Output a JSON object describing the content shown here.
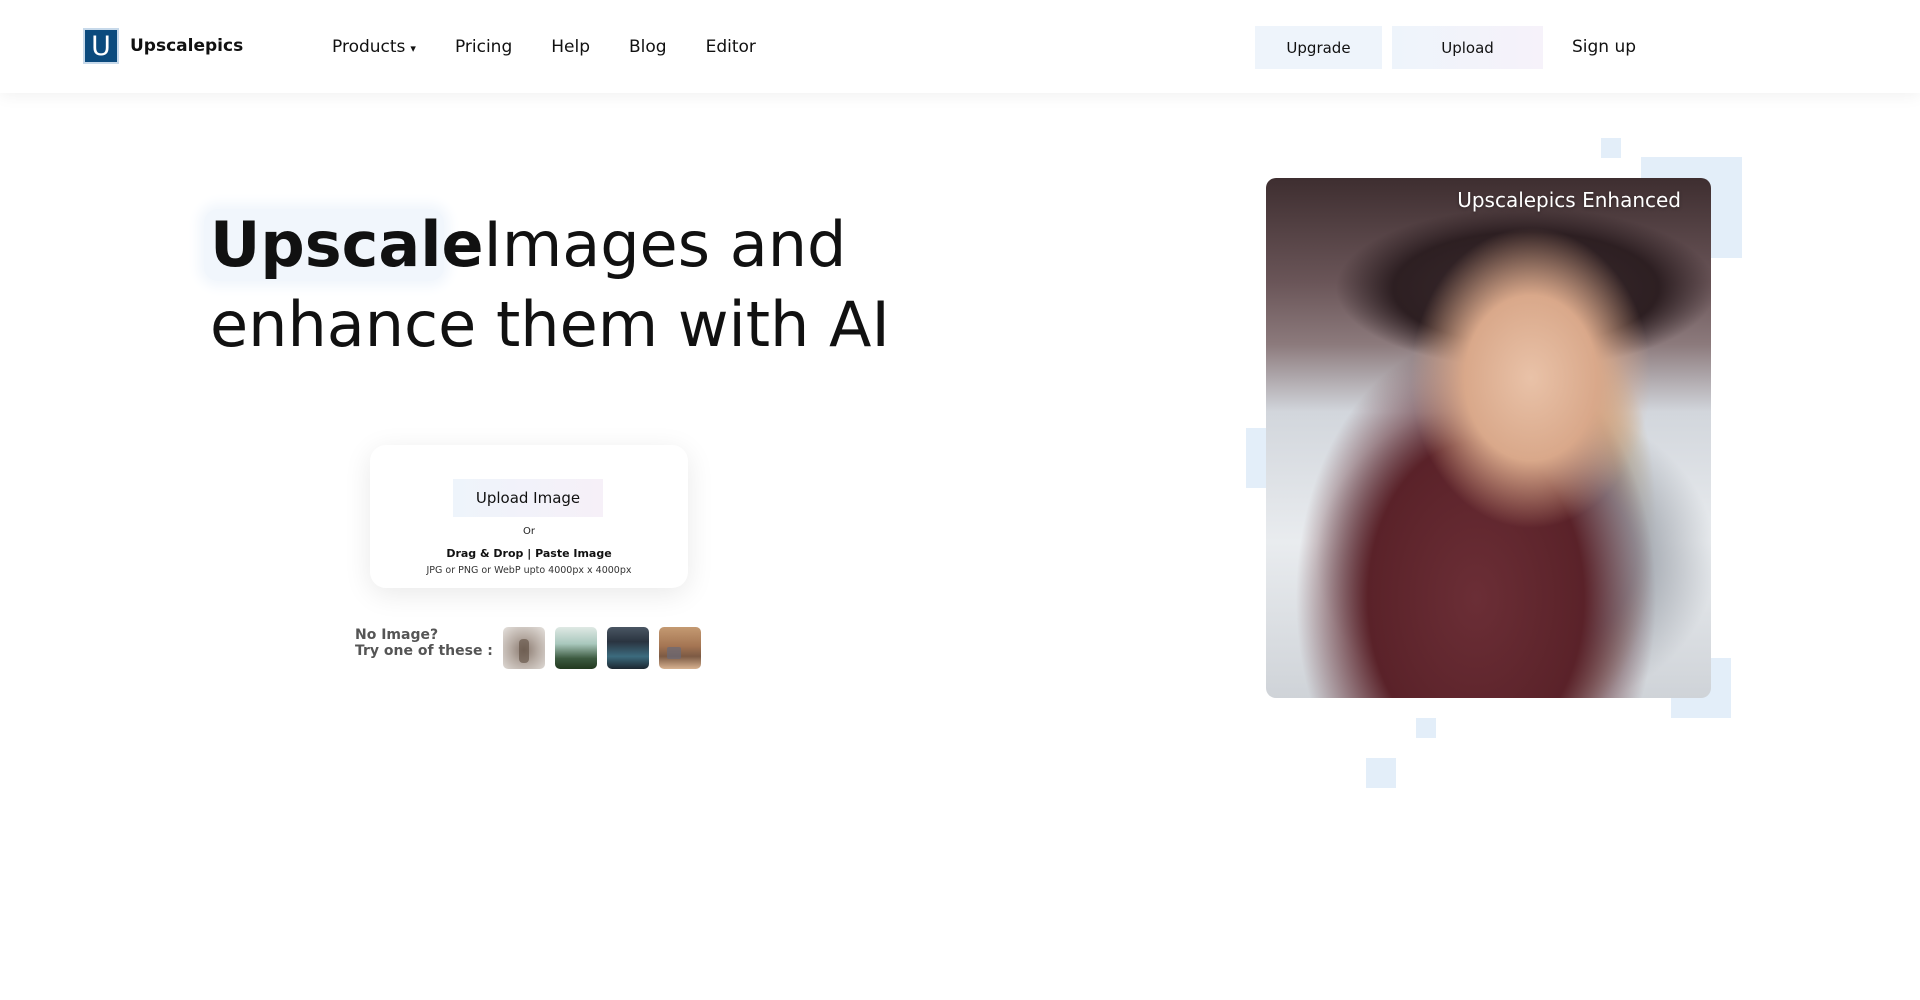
{
  "brand": {
    "logo_letter": "U",
    "name": "Upscalepics",
    "logo_color": "#0b4a7d"
  },
  "nav": {
    "items": [
      {
        "label": "Products",
        "has_dropdown": true
      },
      {
        "label": "Pricing"
      },
      {
        "label": "Help"
      },
      {
        "label": "Blog"
      },
      {
        "label": "Editor"
      }
    ],
    "dropdown_caret": "▾"
  },
  "header_actions": {
    "upgrade_label": "Upgrade",
    "upload_label": "Upload",
    "signup_label": "Sign up"
  },
  "hero": {
    "highlight_word": "Upscale",
    "line1_rest": "Images and",
    "line2": "enhance them with AI"
  },
  "upload_card": {
    "button_label": "Upload Image",
    "or_text": "Or",
    "drag_drop_text": "Drag & Drop | Paste Image",
    "formats_text": "JPG or PNG or WebP upto 4000px x 4000px"
  },
  "samples": {
    "label_line1": "No Image?",
    "label_line2": "Try one of these :",
    "thumbnails": [
      "sample-image-1",
      "sample-image-2",
      "sample-image-3",
      "sample-image-4"
    ]
  },
  "showcase": {
    "label": "Upscalepics Enhanced"
  },
  "colors": {
    "accent_light": "#eef4fb",
    "decor_square": "#e3eef9",
    "text": "#111111"
  }
}
